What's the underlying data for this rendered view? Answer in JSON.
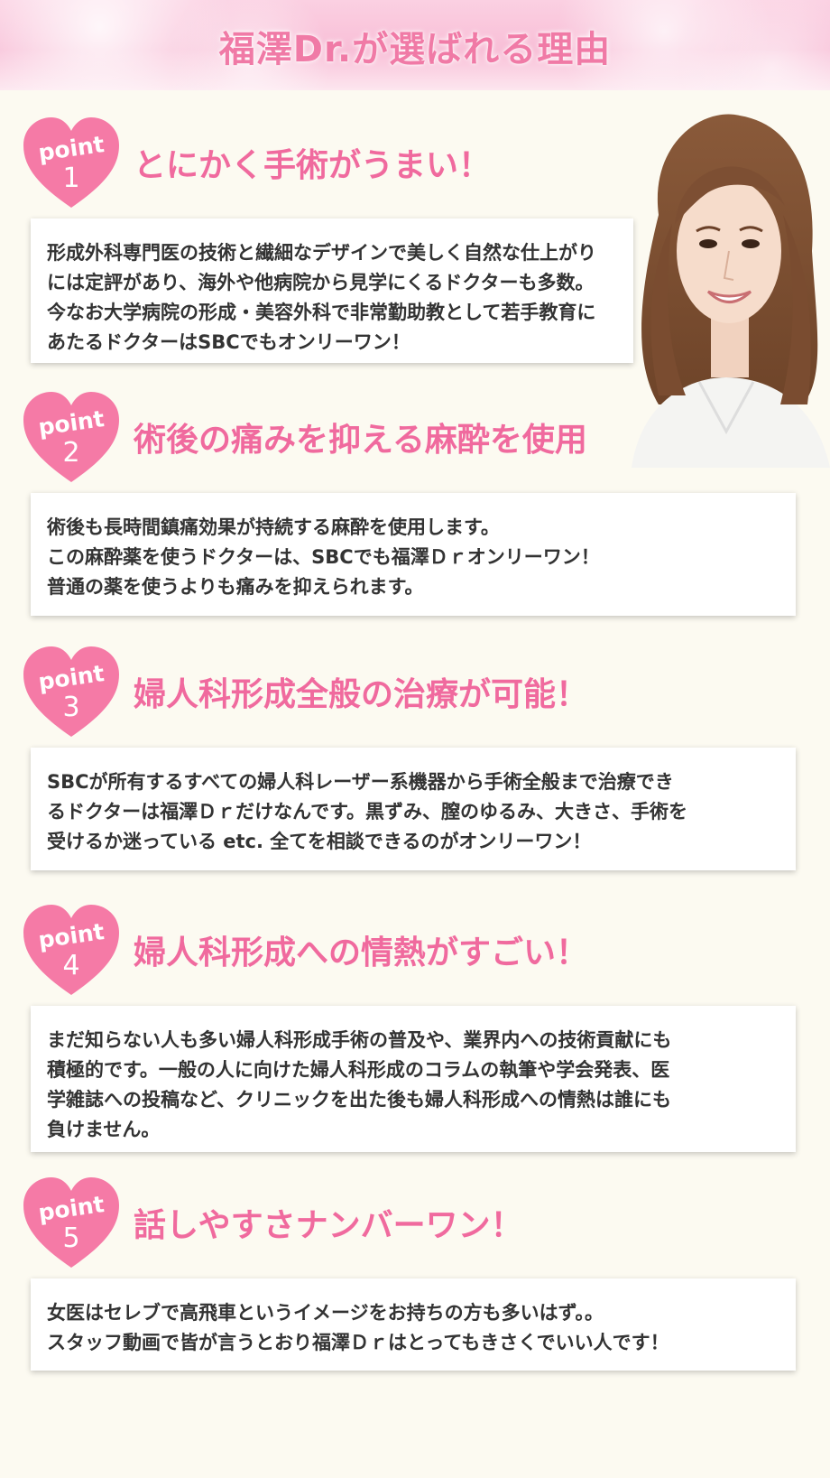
{
  "header": {
    "title": "福澤Dr.が選ばれる理由"
  },
  "points": [
    {
      "badge_word": "point",
      "badge_num": "1",
      "title": "とにかく手術がうまい！",
      "lines": [
        "形成外科専門医の技術と繊細なデザインで美しく自然な仕上がり",
        "には定評があり、海外や他病院から見学にくるドクターも多数。",
        "今なお大学病院の形成・美容外科で非常勤助教として若手教育に",
        "あたるドクターはSBCでもオンリーワン！"
      ]
    },
    {
      "badge_word": "point",
      "badge_num": "2",
      "title": "術後の痛みを抑える麻酔を使用",
      "lines": [
        "術後も長時間鎮痛効果が持続する麻酔を使用します。",
        "この麻酔薬を使うドクターは、SBCでも福澤Ｄｒオンリーワン！",
        "普通の薬を使うよりも痛みを抑えられます。"
      ]
    },
    {
      "badge_word": "point",
      "badge_num": "3",
      "title": "婦人科形成全般の治療が可能！",
      "lines": [
        "SBCが所有するすべての婦人科レーザー系機器から手術全般まで治療でき",
        "るドクターは福澤Ｄｒだけなんです。黒ずみ、膣のゆるみ、大きさ、手術を",
        "受けるか迷っている etc. 全てを相談できるのがオンリーワン！"
      ]
    },
    {
      "badge_word": "point",
      "badge_num": "4",
      "title": "婦人科形成への情熱がすごい！",
      "lines": [
        "まだ知らない人も多い婦人科形成手術の普及や、業界内への技術貢献にも",
        "積極的です。一般の人に向けた婦人科形成のコラムの執筆や学会発表、医",
        "学雑誌への投稿など、クリニックを出た後も婦人科形成への情熱は誰にも",
        "負けません。"
      ]
    },
    {
      "badge_word": "point",
      "badge_num": "5",
      "title": "話しやすさナンバーワン！",
      "lines": [
        "女医はセレブで高飛車というイメージをお持ちの方も多いはず。。",
        "スタッフ動画で皆が言うとおり福澤Ｄｒはとってもきさくでいい人です！"
      ]
    }
  ],
  "colors": {
    "accent": "#f06a9e",
    "heart": "#f57aa6",
    "background": "#fcfaf1"
  }
}
